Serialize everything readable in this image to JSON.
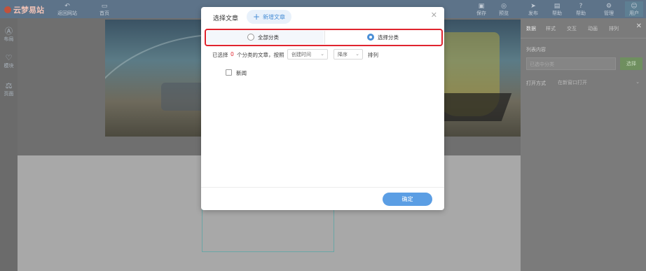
{
  "app": {
    "logo_text": "云梦易站"
  },
  "topbar": {
    "left_items": [
      {
        "label": "返回网站",
        "icon": "undo-icon"
      },
      {
        "label": "首页",
        "icon": "page-icon"
      }
    ],
    "right_items": [
      {
        "label": "保存",
        "icon": "save-icon"
      },
      {
        "label": "预览",
        "icon": "preview-icon"
      },
      {
        "label": "发布",
        "icon": "publish-icon"
      },
      {
        "label": "帮助",
        "icon": "help-icon"
      },
      {
        "label": "帮助",
        "icon": "question-icon"
      },
      {
        "label": "管理",
        "icon": "manage-icon"
      },
      {
        "label": "用户",
        "icon": "user-icon"
      }
    ]
  },
  "leftbar": {
    "items": [
      {
        "label": "布局",
        "icon": "layout-icon"
      },
      {
        "label": "模块",
        "icon": "module-icon"
      },
      {
        "label": "页面",
        "icon": "pages-icon"
      }
    ]
  },
  "rightpanel": {
    "tabs": [
      "数据",
      "样式",
      "交互",
      "动画",
      "排列"
    ],
    "content_label": "列表内容",
    "input_placeholder": "已选中分类",
    "select_button": "选择",
    "open_label": "打开方式",
    "open_value": "在新窗口打开"
  },
  "modal": {
    "title": "选择文章",
    "new_article": "新增文章",
    "radio_all": "全部分类",
    "radio_choose": "选择分类",
    "selected_radio": "选择分类",
    "filter": {
      "prefix": "已选择",
      "count": "0",
      "middle": "个分类的文章，按照",
      "sort_field": "创建时间",
      "sort_order": "降序",
      "suffix": "排列"
    },
    "categories": [
      {
        "label": "新闻",
        "checked": false
      }
    ],
    "ok": "确定"
  },
  "colors": {
    "accent": "#5b9ee4",
    "highlight_border": "#e0242e",
    "count_color": "#e0242e"
  }
}
